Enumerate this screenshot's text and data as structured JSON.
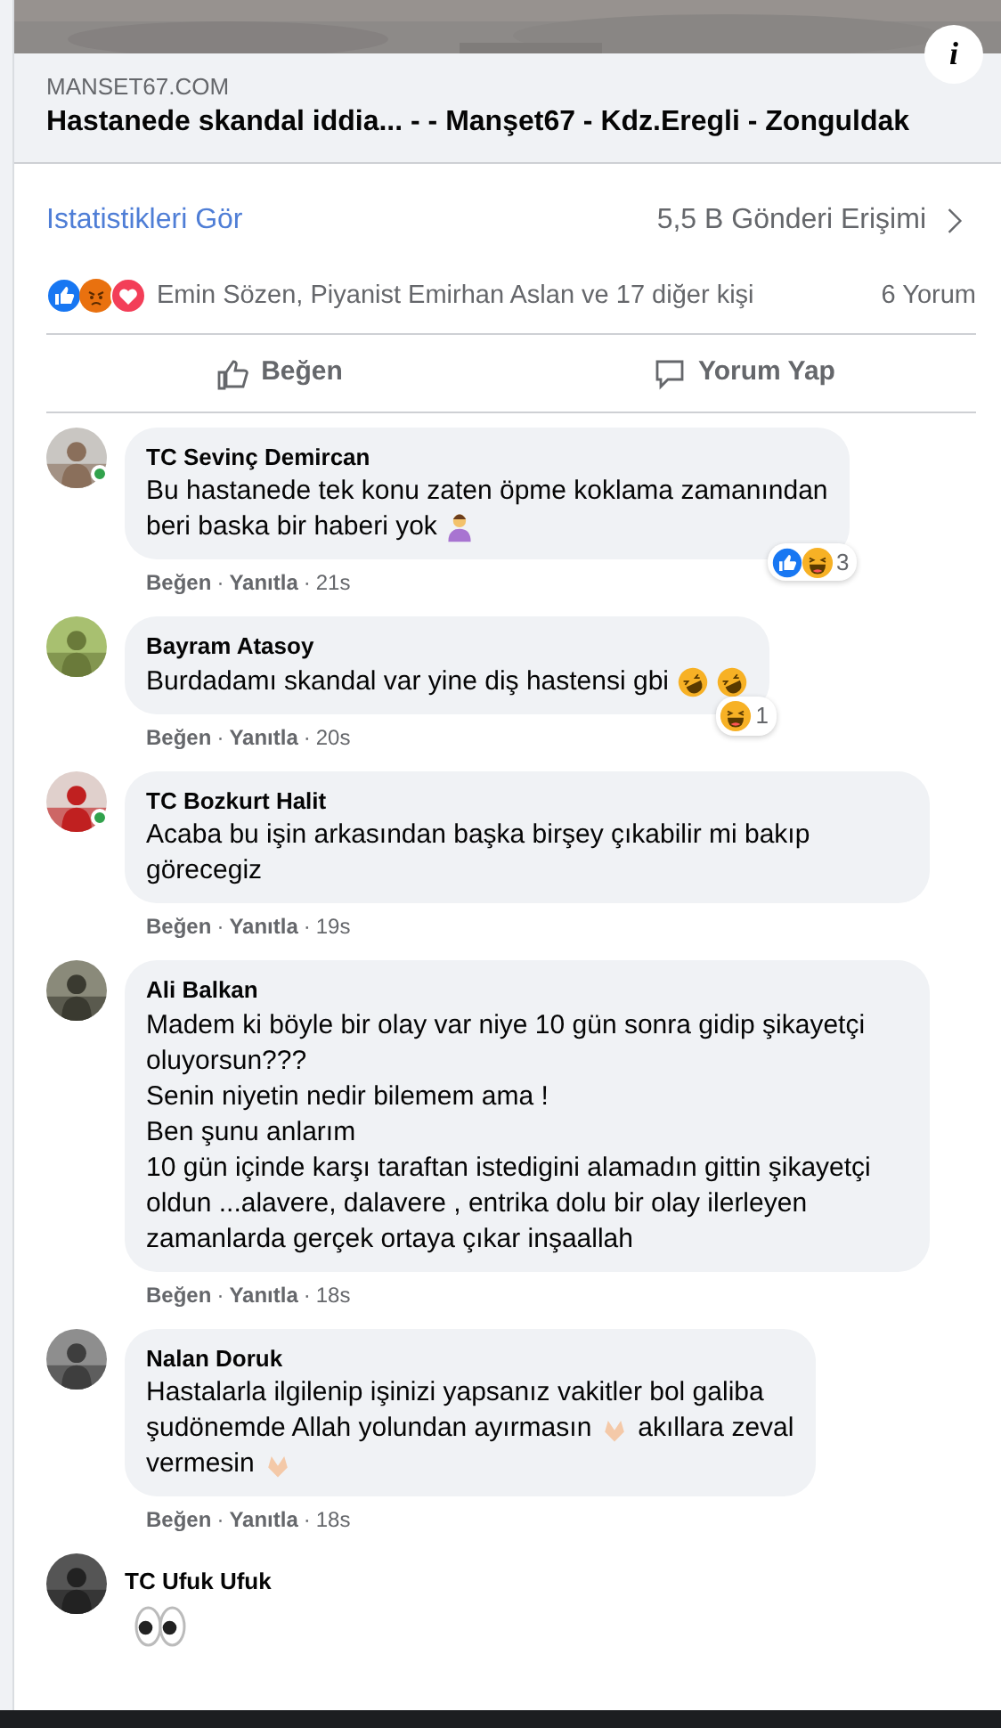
{
  "link_preview": {
    "domain": "MANSET67.COM",
    "title": "Hastanede skandal iddia... - - Manşet67 - Kdz.Eregli - Zonguldak",
    "info": "i"
  },
  "insights": {
    "link": "Istatistikleri Gör",
    "reach": "5,5 B Gönderi Erişimi"
  },
  "reactions": {
    "icons": [
      {
        "kind": "like"
      },
      {
        "kind": "angry"
      },
      {
        "kind": "love"
      }
    ],
    "summary": "Emin Sözen, Piyanist Emirhan Aslan ve 17 diğer kişi",
    "comments": "6 Yorum"
  },
  "actions": [
    "Beğen",
    "Yorum Yap"
  ],
  "comments": [
    {
      "author": "TC Sevinç Demircan",
      "online": true,
      "lines": [
        [
          {
            "kind": "text",
            "text": "Bu hastanede tek konu zaten öpme koklama zamanından"
          }
        ],
        [
          {
            "kind": "text",
            "text": "beri baska bir haberi yok"
          },
          {
            "kind": "person"
          }
        ]
      ],
      "like": "Beğen",
      "reply": "Yanıtla",
      "separators": [
        "·",
        "·"
      ],
      "time": "21s",
      "reaction_icons": [
        {
          "kind": "like"
        },
        {
          "kind": "haha"
        }
      ],
      "reaction_count": "3"
    },
    {
      "author": "Bayram Atasoy",
      "online": false,
      "lines": [
        [
          {
            "kind": "text",
            "text": "Burdadamı skandal var yine diş hastensi gbi"
          },
          {
            "kind": "rofl"
          },
          {
            "kind": "rofl"
          }
        ]
      ],
      "like": "Beğen",
      "reply": "Yanıtla",
      "separators": [
        "·",
        "·"
      ],
      "time": "20s",
      "reaction_icons": [
        {
          "kind": "haha"
        }
      ],
      "reaction_count": "1"
    },
    {
      "author": "TC Bozkurt Halit",
      "online": true,
      "lines": [
        [
          {
            "kind": "text",
            "text": "Acaba bu işin arkasından başka birşey çıkabilir mi bakıp görecegiz"
          }
        ]
      ],
      "like": "Beğen",
      "reply": "Yanıtla",
      "separators": [
        "·",
        "·"
      ],
      "time": "19s"
    },
    {
      "author": "Ali Balkan",
      "online": false,
      "lines": [
        [
          {
            "kind": "text",
            "text": "Madem ki böyle bir olay var niye 10 gün sonra gidip şikayetçi oluyorsun???"
          }
        ],
        [
          {
            "kind": "text",
            "text": "Senin niyetin nedir bilemem ama !"
          }
        ],
        [
          {
            "kind": "text",
            "text": "Ben şunu anlarım"
          }
        ],
        [
          {
            "kind": "text",
            "text": "10 gün içinde karşı taraftan istedigini alamadın gittin şikayetçi oldun ...alavere, dalavere , entrika dolu bir olay ilerleyen zamanlarda gerçek ortaya çıkar inşaallah"
          }
        ]
      ],
      "like": "Beğen",
      "reply": "Yanıtla",
      "separators": [
        "·",
        "·"
      ],
      "time": "18s"
    },
    {
      "author": "Nalan Doruk",
      "online": false,
      "lines": [
        [
          {
            "kind": "text",
            "text": "Hastalarla ilgilenip işinizi yapsanız vakitler bol galiba"
          }
        ],
        [
          {
            "kind": "text",
            "text": "şudönemde Allah yolundan ayırmasın"
          },
          {
            "kind": "hands"
          },
          {
            "kind": "text",
            "text": "akıllara zeval"
          }
        ],
        [
          {
            "kind": "text",
            "text": "vermesin"
          },
          {
            "kind": "hands"
          }
        ]
      ],
      "like": "Beğen",
      "reply": "Yanıtla",
      "separators": [
        "·",
        "·"
      ],
      "time": "18s"
    },
    {
      "author": "TC Ufuk Ufuk",
      "online": false,
      "lines": [
        [
          {
            "kind": "eyes"
          }
        ]
      ]
    }
  ]
}
